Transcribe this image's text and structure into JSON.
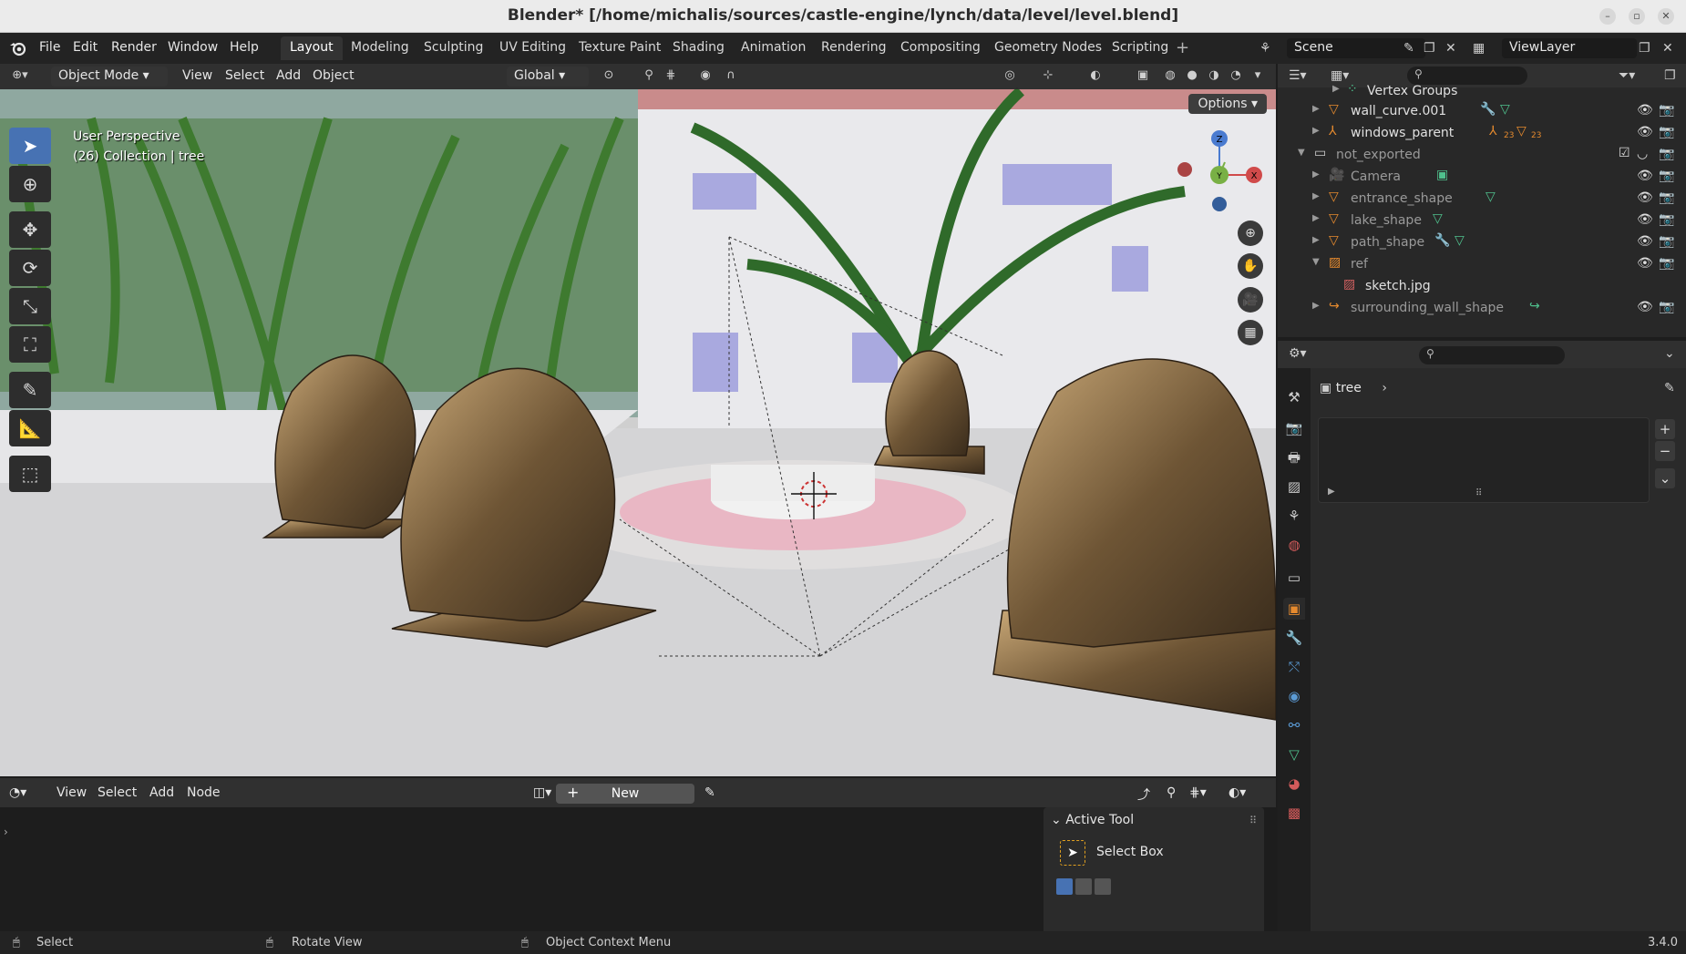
{
  "window": {
    "title": "Blender* [/home/michalis/sources/castle-engine/lynch/data/level/level.blend]",
    "buttons": [
      "–",
      "▫",
      "✕"
    ]
  },
  "topbar": {
    "menus": [
      "File",
      "Edit",
      "Render",
      "Window",
      "Help"
    ],
    "workspace_tabs": [
      "Layout",
      "Modeling",
      "Sculpting",
      "UV Editing",
      "Texture Paint",
      "Shading",
      "Animation",
      "Rendering",
      "Compositing",
      "Geometry Nodes",
      "Scripting"
    ],
    "active_tab": "Layout",
    "scene": "Scene",
    "view_layer": "ViewLayer"
  },
  "viewport": {
    "mode": "Object Mode",
    "menus": [
      "View",
      "Select",
      "Add",
      "Object"
    ],
    "transform_orientation": "Global",
    "options_label": "Options",
    "info_line1": "User Perspective",
    "info_line2": "(26) Collection | tree",
    "gizmo_axes": [
      "Z",
      "Y",
      "X"
    ]
  },
  "outliner": {
    "rows": [
      {
        "label": "Vertex Groups",
        "icon": "vertex-groups-icon",
        "dim": false
      },
      {
        "label": "wall_curve.001",
        "icon": "mesh-icon",
        "dim": false
      },
      {
        "label": "windows_parent",
        "icon": "empty-icon",
        "dim": false,
        "extra": "23"
      },
      {
        "label": "not_exported",
        "icon": "collection-icon",
        "dim": true
      },
      {
        "label": "Camera",
        "icon": "camera-icon",
        "dim": true
      },
      {
        "label": "entrance_shape",
        "icon": "mesh-icon",
        "dim": true
      },
      {
        "label": "lake_shape",
        "icon": "mesh-icon",
        "dim": true
      },
      {
        "label": "path_shape",
        "icon": "mesh-icon",
        "dim": true
      },
      {
        "label": "ref",
        "icon": "image-icon",
        "dim": true
      },
      {
        "label": "sketch.jpg",
        "icon": "image-data-icon",
        "dim": false
      },
      {
        "label": "surrounding_wall_shape",
        "icon": "curve-icon",
        "dim": true
      }
    ]
  },
  "properties": {
    "object_name": "tree"
  },
  "node_editor": {
    "menus": [
      "View",
      "Select",
      "Add",
      "Node"
    ],
    "new_label": "New",
    "active_tool_header": "Active Tool",
    "active_tool_name": "Select Box"
  },
  "statusbar": {
    "items": [
      "Select",
      "Rotate View",
      "Object Context Menu"
    ],
    "version": "3.4.0"
  }
}
